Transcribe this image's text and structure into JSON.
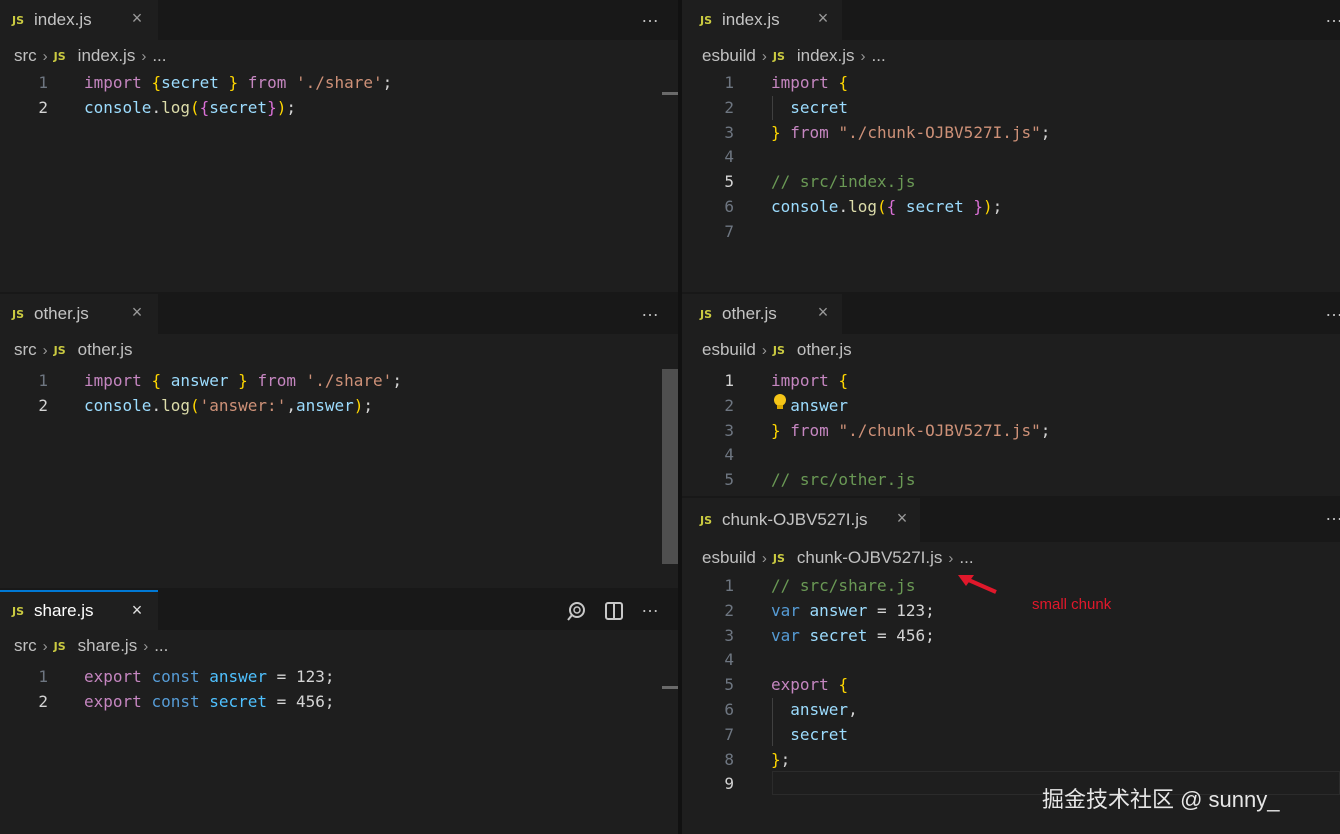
{
  "panes": {
    "left_index": {
      "tab_label": "index.js",
      "breadcrumb": [
        "src",
        "index.js",
        "..."
      ],
      "lines": [
        {
          "n": "1",
          "tokens": [
            [
              "kw",
              "import"
            ],
            [
              "plain",
              " "
            ],
            [
              "br",
              "{"
            ],
            [
              "var",
              "secret"
            ],
            [
              "plain",
              " "
            ],
            [
              "br",
              "}"
            ],
            [
              "plain",
              " "
            ],
            [
              "kw",
              "from"
            ],
            [
              "plain",
              " "
            ],
            [
              "str",
              "'./share'"
            ],
            [
              "pun",
              ";"
            ]
          ]
        },
        {
          "n": "2",
          "tokens": [
            [
              "var",
              "console"
            ],
            [
              "pun",
              "."
            ],
            [
              "fn",
              "log"
            ],
            [
              "br",
              "("
            ],
            [
              "br2",
              "{"
            ],
            [
              "var",
              "secret"
            ],
            [
              "br2",
              "}"
            ],
            [
              "br",
              ")"
            ],
            [
              "pun",
              ";"
            ]
          ]
        }
      ]
    },
    "left_other": {
      "tab_label": "other.js",
      "breadcrumb": [
        "src",
        "other.js"
      ],
      "lines": [
        {
          "n": "1",
          "tokens": [
            [
              "kw",
              "import"
            ],
            [
              "plain",
              " "
            ],
            [
              "br",
              "{"
            ],
            [
              "plain",
              " "
            ],
            [
              "var",
              "answer"
            ],
            [
              "plain",
              " "
            ],
            [
              "br",
              "}"
            ],
            [
              "plain",
              " "
            ],
            [
              "kw",
              "from"
            ],
            [
              "plain",
              " "
            ],
            [
              "str",
              "'./share'"
            ],
            [
              "pun",
              ";"
            ]
          ]
        },
        {
          "n": "2",
          "tokens": [
            [
              "var",
              "console"
            ],
            [
              "pun",
              "."
            ],
            [
              "fn",
              "log"
            ],
            [
              "br",
              "("
            ],
            [
              "str",
              "'answer:'"
            ],
            [
              "pun",
              ","
            ],
            [
              "var",
              "answer"
            ],
            [
              "br",
              ")"
            ],
            [
              "pun",
              ";"
            ]
          ]
        }
      ]
    },
    "left_share": {
      "tab_label": "share.js",
      "breadcrumb": [
        "src",
        "share.js",
        "..."
      ],
      "lines": [
        {
          "n": "1",
          "tokens": [
            [
              "kw",
              "export"
            ],
            [
              "plain",
              " "
            ],
            [
              "kw2",
              "const"
            ],
            [
              "plain",
              " "
            ],
            [
              "var2",
              "answer"
            ],
            [
              "plain",
              " = "
            ],
            [
              "plain",
              "123"
            ],
            [
              "pun",
              ";"
            ]
          ]
        },
        {
          "n": "2",
          "tokens": [
            [
              "kw",
              "export"
            ],
            [
              "plain",
              " "
            ],
            [
              "kw2",
              "const"
            ],
            [
              "plain",
              " "
            ],
            [
              "var2",
              "secret"
            ],
            [
              "plain",
              " = "
            ],
            [
              "plain",
              "456"
            ],
            [
              "pun",
              ";"
            ]
          ]
        }
      ]
    },
    "right_index": {
      "tab_label": "index.js",
      "breadcrumb": [
        "esbuild",
        "index.js",
        "..."
      ],
      "lines": [
        {
          "n": "1",
          "tokens": [
            [
              "kw",
              "import"
            ],
            [
              "plain",
              " "
            ],
            [
              "br",
              "{"
            ]
          ]
        },
        {
          "n": "2",
          "tokens": [
            [
              "plain",
              "  "
            ],
            [
              "var",
              "secret"
            ]
          ]
        },
        {
          "n": "3",
          "tokens": [
            [
              "br",
              "}"
            ],
            [
              "plain",
              " "
            ],
            [
              "kw",
              "from"
            ],
            [
              "plain",
              " "
            ],
            [
              "str",
              "\"./chunk-OJBV527I.js\""
            ],
            [
              "pun",
              ";"
            ]
          ]
        },
        {
          "n": "4",
          "tokens": []
        },
        {
          "n": "5",
          "tokens": [
            [
              "cmt",
              "// src/index.js"
            ]
          ]
        },
        {
          "n": "6",
          "tokens": [
            [
              "var",
              "console"
            ],
            [
              "pun",
              "."
            ],
            [
              "fn",
              "log"
            ],
            [
              "br",
              "("
            ],
            [
              "br2",
              "{"
            ],
            [
              "plain",
              " "
            ],
            [
              "var",
              "secret"
            ],
            [
              "plain",
              " "
            ],
            [
              "br2",
              "}"
            ],
            [
              "br",
              ")"
            ],
            [
              "pun",
              ";"
            ]
          ]
        },
        {
          "n": "7",
          "tokens": []
        }
      ]
    },
    "right_other": {
      "tab_label": "other.js",
      "breadcrumb": [
        "esbuild",
        "other.js"
      ],
      "lines": [
        {
          "n": "1",
          "tokens": [
            [
              "kw",
              "import"
            ],
            [
              "plain",
              " "
            ],
            [
              "br",
              "{"
            ]
          ]
        },
        {
          "n": "2",
          "tokens": [
            [
              "plain",
              "  "
            ],
            [
              "var",
              "answer"
            ]
          ]
        },
        {
          "n": "3",
          "tokens": [
            [
              "br",
              "}"
            ],
            [
              "plain",
              " "
            ],
            [
              "kw",
              "from"
            ],
            [
              "plain",
              " "
            ],
            [
              "str",
              "\"./chunk-OJBV527I.js\""
            ],
            [
              "pun",
              ";"
            ]
          ]
        },
        {
          "n": "4",
          "tokens": []
        },
        {
          "n": "5",
          "tokens": [
            [
              "cmt",
              "// src/other.js"
            ]
          ]
        }
      ]
    },
    "right_chunk": {
      "tab_label": "chunk-OJBV527I.js",
      "breadcrumb": [
        "esbuild",
        "chunk-OJBV527I.js",
        "..."
      ],
      "lines": [
        {
          "n": "1",
          "tokens": [
            [
              "cmt",
              "// src/share.js"
            ]
          ]
        },
        {
          "n": "2",
          "tokens": [
            [
              "kw2",
              "var"
            ],
            [
              "plain",
              " "
            ],
            [
              "var",
              "answer"
            ],
            [
              "plain",
              " = "
            ],
            [
              "plain",
              "123"
            ],
            [
              "pun",
              ";"
            ]
          ]
        },
        {
          "n": "3",
          "tokens": [
            [
              "kw2",
              "var"
            ],
            [
              "plain",
              " "
            ],
            [
              "var",
              "secret"
            ],
            [
              "plain",
              " = "
            ],
            [
              "plain",
              "456"
            ],
            [
              "pun",
              ";"
            ]
          ]
        },
        {
          "n": "4",
          "tokens": []
        },
        {
          "n": "5",
          "tokens": [
            [
              "kw",
              "export"
            ],
            [
              "plain",
              " "
            ],
            [
              "br",
              "{"
            ]
          ]
        },
        {
          "n": "6",
          "tokens": [
            [
              "plain",
              "  "
            ],
            [
              "var",
              "answer"
            ],
            [
              "pun",
              ","
            ]
          ]
        },
        {
          "n": "7",
          "tokens": [
            [
              "plain",
              "  "
            ],
            [
              "var",
              "secret"
            ]
          ]
        },
        {
          "n": "8",
          "tokens": [
            [
              "br",
              "}"
            ],
            [
              "pun",
              ";"
            ]
          ]
        },
        {
          "n": "9",
          "tokens": []
        }
      ]
    }
  },
  "annotation": {
    "text": "small chunk",
    "color": "#e0182b"
  },
  "watermark": "掘金技术社区 @ sunny_",
  "icons": {
    "more": "…",
    "close": "×",
    "breadcrumb_sep": "›",
    "js_badge": "JS"
  }
}
